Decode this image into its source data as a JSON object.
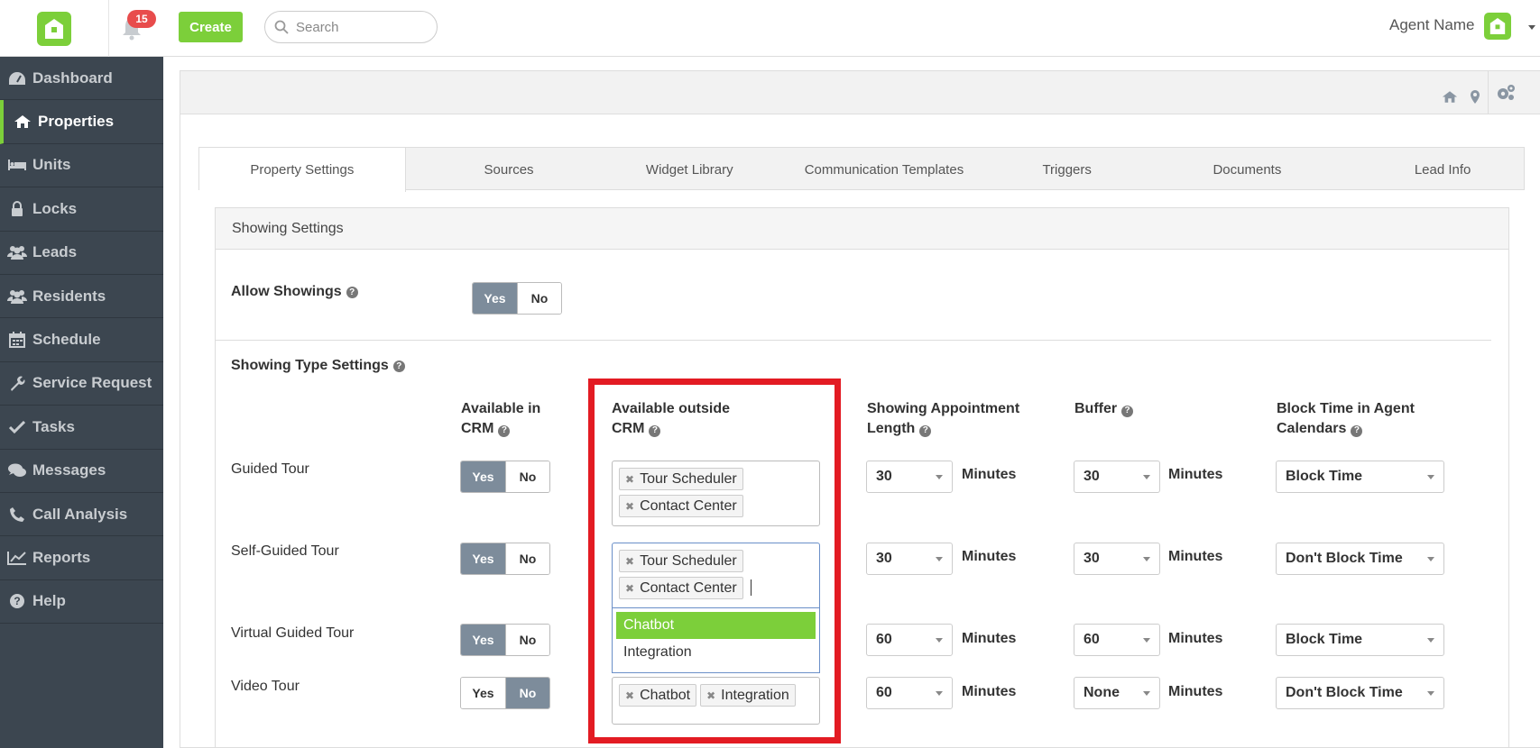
{
  "topbar": {
    "notification_count": "15",
    "create_label": "Create",
    "search_placeholder": "Search",
    "agent_name": "Agent Name"
  },
  "sidebar": {
    "items": [
      {
        "label": "Dashboard",
        "icon": "dashboard-icon"
      },
      {
        "label": "Properties",
        "icon": "home-icon",
        "active": true
      },
      {
        "label": "Units",
        "icon": "bed-icon"
      },
      {
        "label": "Locks",
        "icon": "lock-icon"
      },
      {
        "label": "Leads",
        "icon": "users-icon"
      },
      {
        "label": "Residents",
        "icon": "users-icon"
      },
      {
        "label": "Schedule",
        "icon": "calendar-icon"
      },
      {
        "label": "Service Request",
        "icon": "wrench-icon"
      },
      {
        "label": "Tasks",
        "icon": "check-icon"
      },
      {
        "label": "Messages",
        "icon": "chat-icon"
      },
      {
        "label": "Call Analysis",
        "icon": "phone-icon"
      },
      {
        "label": "Reports",
        "icon": "chart-icon"
      },
      {
        "label": "Help",
        "icon": "help-icon"
      }
    ]
  },
  "tabs": [
    "Property Settings",
    "Sources",
    "Widget Library",
    "Communication Templates",
    "Triggers",
    "Documents",
    "Lead Info"
  ],
  "showing": {
    "section_title": "Showing Settings",
    "allow_label": "Allow Showings",
    "yes": "Yes",
    "no": "No",
    "type_settings_label": "Showing Type Settings",
    "col_crm": [
      "Available in",
      "CRM"
    ],
    "col_outside": [
      "Available outside",
      "CRM"
    ],
    "col_length": [
      "Showing Appointment",
      "Length"
    ],
    "col_buffer": "Buffer",
    "col_block": [
      "Block Time in Agent",
      "Calendars"
    ],
    "minutes": "Minutes",
    "rows": [
      {
        "label": "Guided Tour",
        "crm": "yes",
        "tags": [
          "Tour Scheduler",
          "Contact Center"
        ],
        "length": "30",
        "buffer": "30",
        "block": "Block Time"
      },
      {
        "label": "Self-Guided Tour",
        "crm": "yes",
        "tags": [
          "Tour Scheduler",
          "Contact Center"
        ],
        "length": "30",
        "buffer": "30",
        "block": "Don't Block Time"
      },
      {
        "label": "Virtual Guided Tour",
        "crm": "yes",
        "tags": [],
        "length": "60",
        "buffer": "60",
        "block": "Block Time"
      },
      {
        "label": "Video Tour",
        "crm": "no",
        "tags": [
          "Chatbot",
          "Integration"
        ],
        "length": "60",
        "buffer": "None",
        "block": "Don't Block Time"
      }
    ],
    "dropdown_options": [
      "Chatbot",
      "Integration"
    ]
  },
  "colors": {
    "brand": "#7ccf3a",
    "sidebar": "#3c4650",
    "highlight": "#e31b23",
    "toggle_on": "#7d8c9b"
  }
}
